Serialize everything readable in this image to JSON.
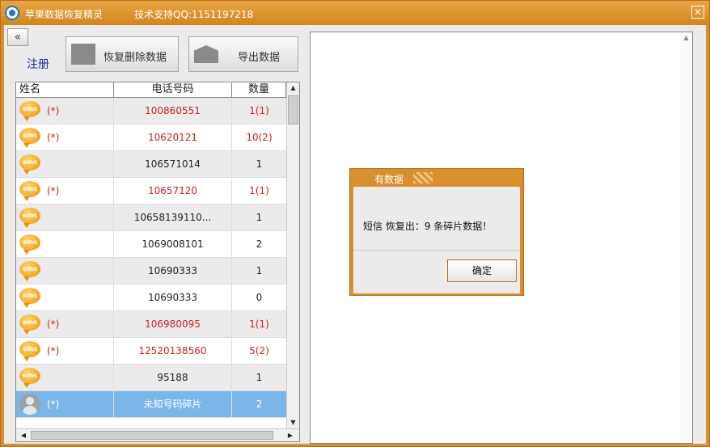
{
  "window": {
    "title": "苹果数据恢复精灵",
    "support": "技术支持QQ:1151197218",
    "close_glyph": "✕"
  },
  "toolbar": {
    "collapse_glyph": "«",
    "register": "注册",
    "restore_label": "恢复删除数据",
    "export_label": "导出数据"
  },
  "table": {
    "headers": {
      "name": "姓名",
      "phone": "电话号码",
      "count": "数量"
    },
    "rows": [
      {
        "icon": "sms-icon",
        "mark": "(*)",
        "phone": "100860551",
        "count": "1(1)",
        "red": true
      },
      {
        "icon": "sms-icon",
        "mark": "(*)",
        "phone": "10620121",
        "count": "10(2)",
        "red": true
      },
      {
        "icon": "sms-icon",
        "mark": "",
        "phone": "106571014",
        "count": "1",
        "red": false
      },
      {
        "icon": "sms-icon",
        "mark": "(*)",
        "phone": "10657120",
        "count": "1(1)",
        "red": true
      },
      {
        "icon": "sms-icon",
        "mark": "",
        "phone": "10658139110...",
        "count": "1",
        "red": false
      },
      {
        "icon": "sms-icon",
        "mark": "",
        "phone": "1069008101",
        "count": "2",
        "red": false
      },
      {
        "icon": "sms-icon",
        "mark": "",
        "phone": "10690333",
        "count": "1",
        "red": false
      },
      {
        "icon": "sms-icon",
        "mark": "",
        "phone": "10690333",
        "count": "0",
        "red": false
      },
      {
        "icon": "sms-icon",
        "mark": "(*)",
        "phone": "106980095",
        "count": "1(1)",
        "red": true
      },
      {
        "icon": "sms-icon",
        "mark": "(*)",
        "phone": "12520138560",
        "count": "5(2)",
        "red": true
      },
      {
        "icon": "sms-icon",
        "mark": "",
        "phone": "95188",
        "count": "1",
        "red": false
      },
      {
        "icon": "person-icon",
        "mark": "(*)",
        "phone": "未知号码碎片",
        "count": "2",
        "red": false,
        "selected": true
      }
    ]
  },
  "dialog": {
    "title": "有数据",
    "message": "短信 恢复出：9 条碎片数据！",
    "ok_label": "确定"
  },
  "colors": {
    "accent": "#d8902e",
    "selected_row": "#7ab7e8",
    "flag_red": "#cc2222"
  }
}
